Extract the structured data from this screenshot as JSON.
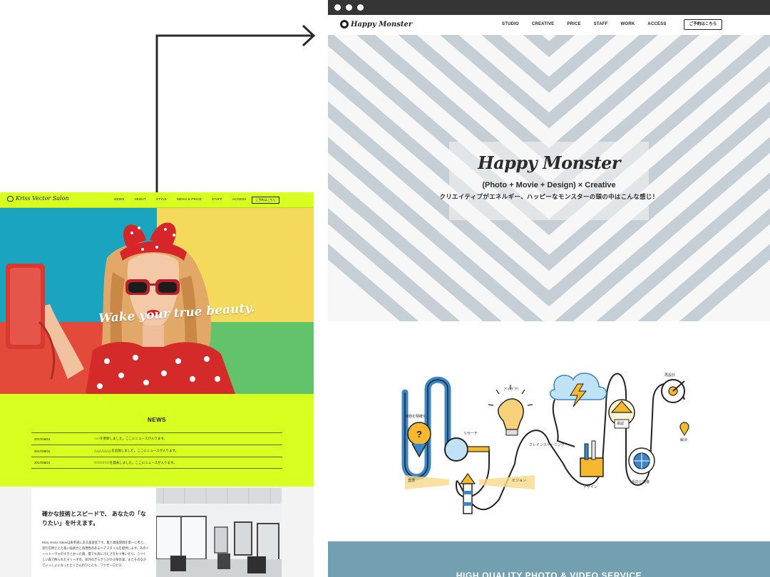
{
  "salon": {
    "logo_text": "Kriss Vector Salon",
    "nav": [
      "NEWS",
      "ABOUT",
      "STYLE",
      "MENU & PRICE",
      "STAFF",
      "ACCESS"
    ],
    "reserve_label": "ご予約はこちら",
    "hero_caption": "Wake your true beauty.",
    "news": {
      "title": "NEWS",
      "items": [
        {
          "date": "2017/08/01",
          "text": "○○○を更新しました。ここにニュースが入ります。"
        },
        {
          "date": "2017/08/01",
          "text": "△△△△△△△を追加しました。ここにニュースが入ります。"
        },
        {
          "date": "2017/08/01",
          "text": "□□□□□□□□を発表しました。ここにニュースが入ります。"
        }
      ]
    },
    "about": {
      "heading": "確かな技術とスピードで、 あなたの「なりたい」を叶えます。",
      "body": "Kriss Vector Salonは表参道にある美容室です。髪と頭皮環境を第一に考え、流行を押さえた高い技術力と再現性のあるヘアスタイルを提供します。あのイーハトーヴォのすきとおった風、夏でも底に冷たさをもつ青いそら、うつくしい森で飾られたモリーオ市、郊外のぎらぎらひかる草の波。またそのなかでいっしょになったたくさんのひとたち、ファゼーロとロ…"
    }
  },
  "happy_monster": {
    "logo_text": "Happy Monster",
    "nav": [
      "STUDIO",
      "CREATIVE",
      "PRICE",
      "STAFF",
      "WORK",
      "ACCESS"
    ],
    "reserve_label": "ご予約はこちら",
    "hero": {
      "title": "Happy Monster",
      "tagline": "(Photo + Movie + Design) × Creative",
      "subtitle": "クリエイティブがエネルギー、ハッピーなモンスターの頭の中はこんな感じ！"
    },
    "process_labels": {
      "research": "リサーチ",
      "idea": "アイデア!",
      "brainstorm": "ブレインストーミング",
      "problem": "課題を明確化",
      "insight": "直感",
      "vision": "ビジョン",
      "design": "デザイン",
      "approve": "承認",
      "redesign": "再設計",
      "feedback": "反応と実装",
      "solution": "解決",
      "approve_sign": "承認"
    },
    "service_title": "HIGH QUALITY PHOTO & VIDEO SERVICE"
  },
  "colors": {
    "salon_lime": "#d7ff1f",
    "stripe_grey": "#c6ced6",
    "service_teal": "#72a0b1",
    "chrome_dark": "#353535",
    "accent_blue": "#3a86c8",
    "accent_yellow": "#f5b82e"
  }
}
